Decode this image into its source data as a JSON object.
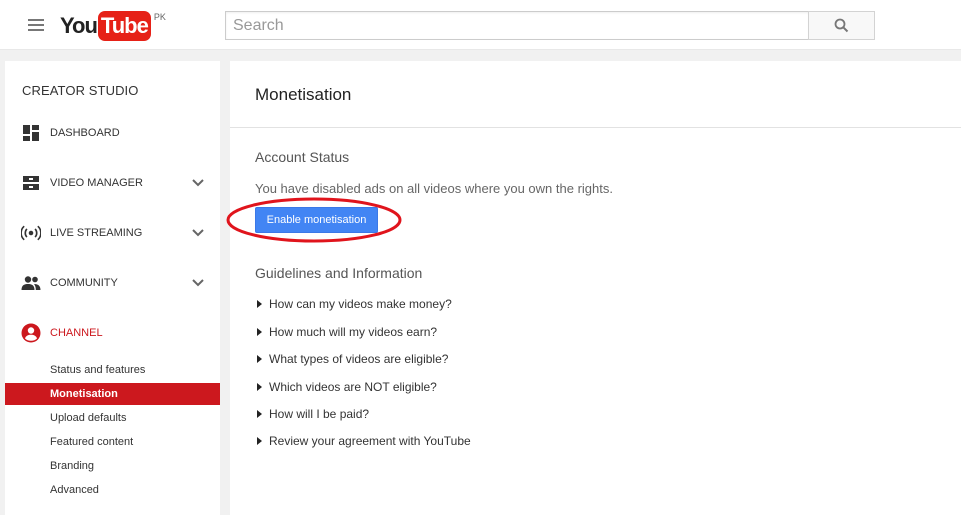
{
  "header": {
    "logo_you": "You",
    "logo_tube": "Tube",
    "logo_country": "PK",
    "search_placeholder": "Search"
  },
  "sidebar": {
    "title": "CREATOR STUDIO",
    "items": [
      {
        "label": "DASHBOARD",
        "icon": "dashboard-icon"
      },
      {
        "label": "VIDEO MANAGER",
        "icon": "video-manager-icon"
      },
      {
        "label": "LIVE STREAMING",
        "icon": "live-streaming-icon"
      },
      {
        "label": "COMMUNITY",
        "icon": "community-icon"
      },
      {
        "label": "CHANNEL",
        "icon": "channel-icon"
      }
    ],
    "channel_subitems": [
      {
        "label": "Status and features"
      },
      {
        "label": "Monetisation"
      },
      {
        "label": "Upload defaults"
      },
      {
        "label": "Featured content"
      },
      {
        "label": "Branding"
      },
      {
        "label": "Advanced"
      }
    ]
  },
  "main": {
    "title": "Monetisation",
    "account_status_heading": "Account Status",
    "status_text": "You have disabled ads on all videos where you own the rights.",
    "enable_button": "Enable monetisation",
    "guidelines_heading": "Guidelines and Information",
    "guidelines": [
      {
        "label": "How can my videos make money?"
      },
      {
        "label": "How much will my videos earn?"
      },
      {
        "label": "What types of videos are eligible?"
      },
      {
        "label": "Which videos are NOT eligible?"
      },
      {
        "label": "How will I be paid?"
      },
      {
        "label": "Review your agreement with YouTube"
      }
    ]
  },
  "colors": {
    "brand_red": "#cc181e",
    "button_blue": "#4285f4",
    "annotation_red": "#e0141c"
  }
}
